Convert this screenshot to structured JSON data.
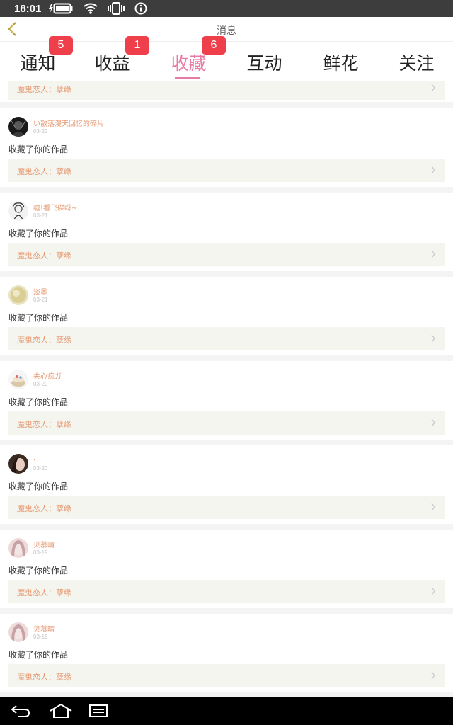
{
  "status_bar": {
    "time": "18:01",
    "icons": [
      "battery-charging-icon",
      "wifi-icon",
      "vibrate-icon",
      "info-icon"
    ]
  },
  "header": {
    "title": "消息",
    "back_icon": "chevron-left-icon"
  },
  "tabs": [
    {
      "label": "通知",
      "badge": "5",
      "active": false
    },
    {
      "label": "收益",
      "badge": "1",
      "active": false
    },
    {
      "label": "收藏",
      "badge": "6",
      "active": true
    },
    {
      "label": "互动",
      "badge": "",
      "active": false
    },
    {
      "label": "鲜花",
      "badge": "",
      "active": false
    },
    {
      "label": "关注",
      "badge": "",
      "active": false
    }
  ],
  "feed": {
    "partial_item": {
      "work_title": "魔鬼恋人：孽缘"
    },
    "items": [
      {
        "username": "い散落漫天回忆的碎片",
        "date": "03-22",
        "action": "收藏了你的作品",
        "work_title": "魔鬼恋人：孽缘",
        "avatar": "dark-avatar"
      },
      {
        "username": "嘘!看飞碟呀~",
        "date": "03-21",
        "action": "收藏了你的作品",
        "work_title": "魔鬼恋人：孽缘",
        "avatar": "sketch-avatar"
      },
      {
        "username": "淡墨",
        "date": "03-21",
        "action": "收藏了你的作品",
        "work_title": "魔鬼恋人：孽缘",
        "avatar": "gold-avatar"
      },
      {
        "username": "失心疯ガ",
        "date": "03-20",
        "action": "收藏了你的作品",
        "work_title": "魔鬼恋人：孽缘",
        "avatar": "cake-avatar"
      },
      {
        "username": ".",
        "date": "03-20",
        "action": "收藏了你的作品",
        "work_title": "魔鬼恋人：孽缘",
        "avatar": "girl-avatar"
      },
      {
        "username": "贝慕晴",
        "date": "03-19",
        "action": "收藏了你的作品",
        "work_title": "魔鬼恋人：孽缘",
        "avatar": "pink-avatar"
      },
      {
        "username": "贝慕晴",
        "date": "03-19",
        "action": "收藏了你的作品",
        "work_title": "魔鬼恋人：孽缘",
        "avatar": "pink-avatar"
      }
    ]
  },
  "nav_bar": {
    "buttons": [
      "back-nav-icon",
      "home-nav-icon",
      "recents-nav-icon"
    ]
  },
  "colors": {
    "accent_pink": "#e87aa6",
    "badge_red": "#ef3f4b",
    "username_orange": "#e69a73",
    "work_bg": "#f5f5ef"
  }
}
